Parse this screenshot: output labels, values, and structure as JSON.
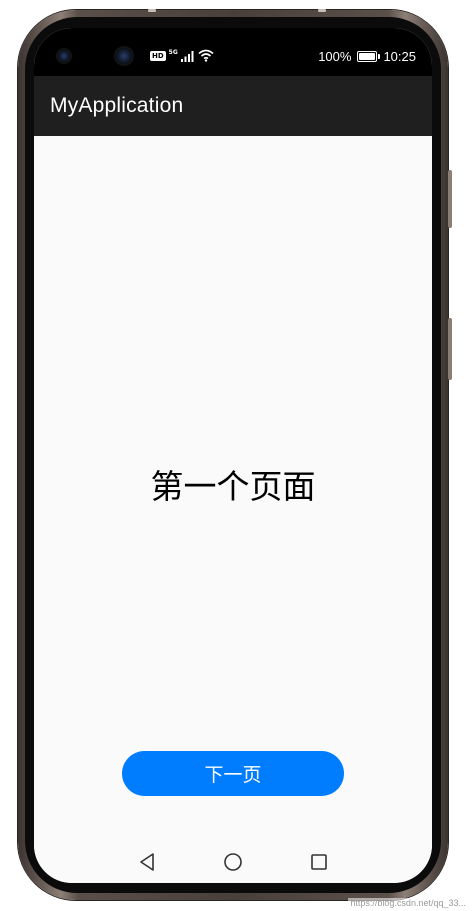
{
  "status_bar": {
    "hd_label": "HD",
    "network_label": "5G",
    "battery_percent": "100%",
    "battery_level": 1.0,
    "time": "10:25",
    "icons": [
      "signal-icon",
      "wifi-icon",
      "battery-icon"
    ]
  },
  "app_bar": {
    "title": "MyApplication"
  },
  "main": {
    "heading": "第一个页面",
    "next_button_label": "下一页"
  },
  "navigation": {
    "icons": [
      "back-icon",
      "home-icon",
      "recent-apps-icon"
    ]
  },
  "watermark": "https://blog.csdn.net/qq_33...",
  "colors": {
    "accent": "#007dff",
    "app_bar_background": "#1f1f1f",
    "status_bar_background": "#000000",
    "content_background": "#fafafa"
  }
}
